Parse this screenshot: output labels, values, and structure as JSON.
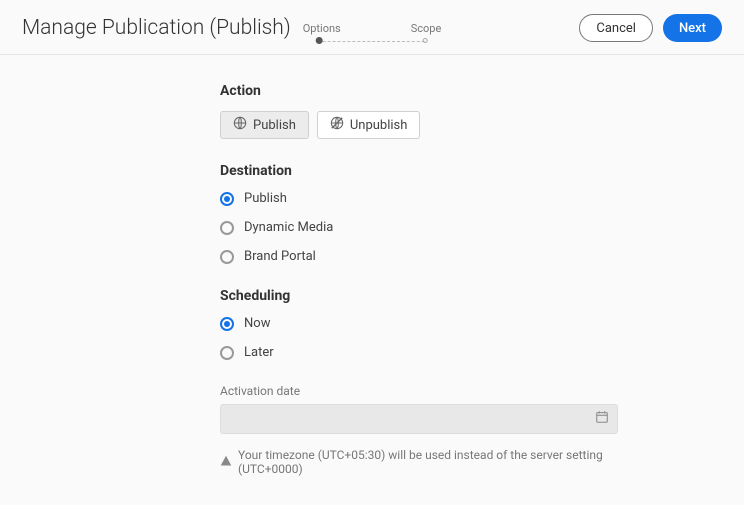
{
  "header": {
    "title": "Manage Publication (Publish)",
    "steps": {
      "one": "Options",
      "two": "Scope"
    },
    "cancel": "Cancel",
    "next": "Next"
  },
  "action": {
    "heading": "Action",
    "publish": "Publish",
    "unpublish": "Unpublish"
  },
  "destination": {
    "heading": "Destination",
    "opts": {
      "publish": "Publish",
      "dynamic": "Dynamic Media",
      "brand": "Brand Portal"
    },
    "selected": "publish"
  },
  "scheduling": {
    "heading": "Scheduling",
    "opts": {
      "now": "Now",
      "later": "Later"
    },
    "selected": "now"
  },
  "activation": {
    "label": "Activation date",
    "value": ""
  },
  "timezone_note": "Your timezone (UTC+05:30) will be used instead of the server setting (UTC+0000)"
}
